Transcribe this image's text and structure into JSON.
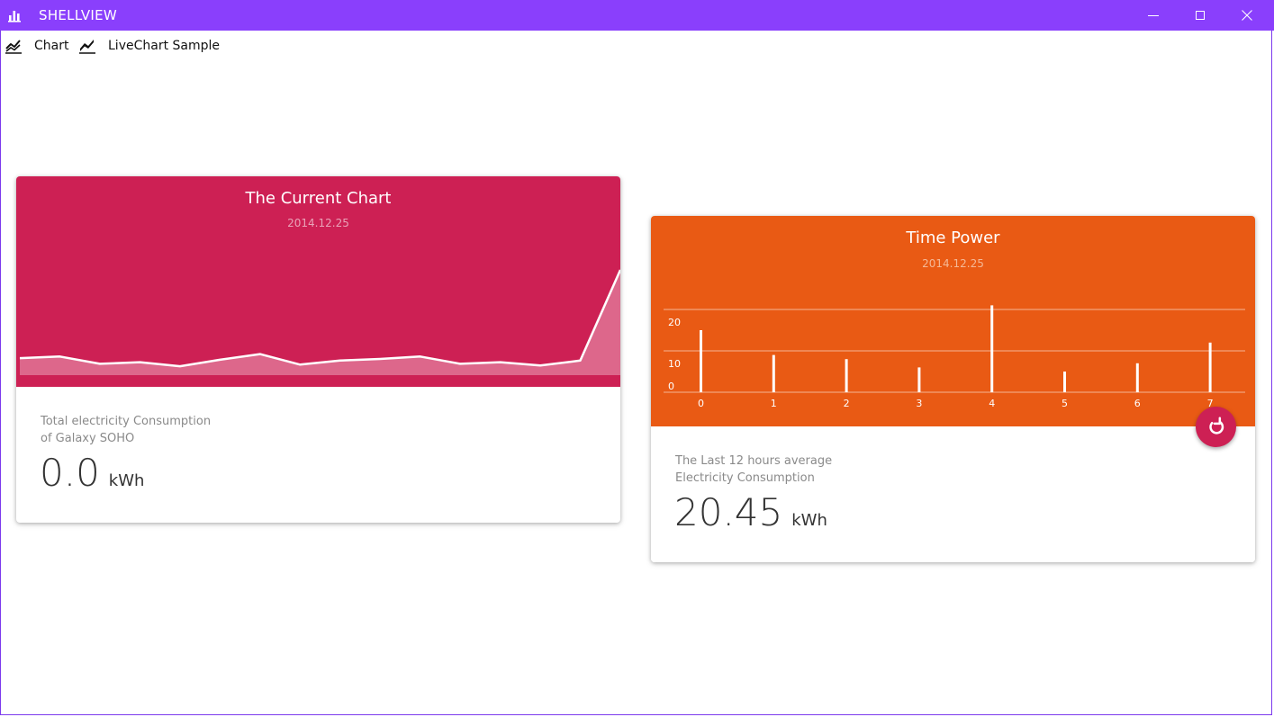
{
  "window": {
    "title": "SHELLVIEW",
    "app_icon": "bar-chart-icon",
    "accent_color": "#8a3ffc",
    "controls": [
      "minimize-icon",
      "maximize-icon",
      "close-icon"
    ]
  },
  "menu": {
    "items": [
      {
        "label": "Chart",
        "icon": "line-chart-icon"
      },
      {
        "label": "LiveChart Sample",
        "icon": "trend-line-icon"
      }
    ]
  },
  "cards": {
    "current": {
      "title": "The Current Chart",
      "date": "2014.12.25",
      "color": "#cd2054",
      "description_line1": "Total electricity Consumption",
      "description_line2": "of Galaxy SOHO",
      "value": "0.0",
      "unit": "kWh"
    },
    "time_power": {
      "title": "Time Power",
      "date": "2014.12.25",
      "color": "#e95a14",
      "description_line1": "The Last 12 hours average",
      "description_line2": "Electricity Consumption",
      "value": "20.45",
      "unit": "kWh",
      "refresh_icon": "refresh-icon"
    }
  },
  "chart_data": [
    {
      "type": "area",
      "values": [
        2.1,
        2.3,
        1.4,
        1.6,
        1.1,
        1.9,
        2.6,
        1.3,
        1.8,
        2.0,
        2.3,
        1.4,
        1.6,
        1.2,
        1.8,
        13.0
      ]
    },
    {
      "type": "bar",
      "categories": [
        "0",
        "1",
        "2",
        "3",
        "4",
        "5",
        "6",
        "7"
      ],
      "values": [
        15,
        9,
        8,
        6,
        21,
        5,
        7,
        12
      ],
      "yticks": [
        "0",
        "10",
        "20"
      ],
      "grid": true
    }
  ]
}
